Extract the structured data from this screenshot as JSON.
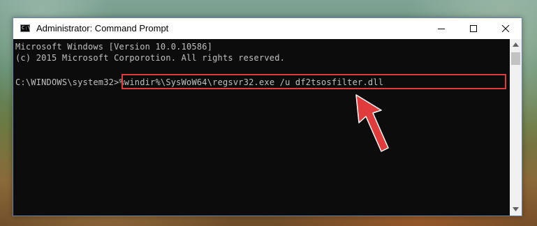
{
  "window": {
    "title": "Administrator: Command Prompt",
    "icon": "cmd-icon"
  },
  "controls": {
    "minimize_icon": "minimize-icon",
    "maximize_icon": "maximize-icon",
    "close_icon": "close-icon"
  },
  "console": {
    "lines": [
      "Microsoft Windows [Version 10.0.10586]",
      "(c) 2015 Microsoft Corporotion. All rights reserved."
    ],
    "prompt": "C:\\WINDOWS\\system32>",
    "command": "%windir%\\SysWoW64\\regsvr32.exe /u df2tsosfilter.dll"
  },
  "annotation": {
    "highlight_color": "#e03c3c",
    "arrow_color": "#e03c3c",
    "arrow_icon": "arrow-pointer-icon"
  },
  "colors": {
    "console_bg": "#0c0c0c",
    "console_text": "#c0c0c0"
  }
}
